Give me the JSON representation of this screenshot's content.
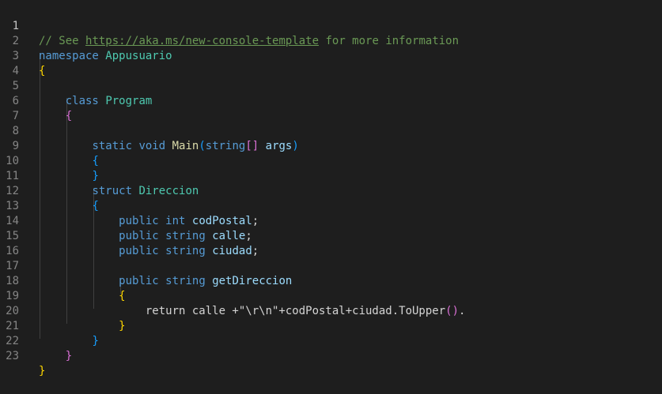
{
  "editor": {
    "line_numbers": [
      "1",
      "2",
      "3",
      "4",
      "5",
      "6",
      "7",
      "8",
      "9",
      "10",
      "11",
      "12",
      "13",
      "14",
      "15",
      "16",
      "17",
      "18",
      "19",
      "20",
      "21",
      "22",
      "23"
    ],
    "tokens": {
      "l1_comment_prefix": "// See ",
      "l1_link": "https://aka.ms/new-console-template",
      "l1_comment_suffix": " for more information",
      "kw_namespace": "namespace",
      "ns_name": "Appusuario",
      "brace_open": "{",
      "brace_close": "}",
      "kw_class": "class",
      "class_name": "Program",
      "kw_static": "static",
      "kw_void": "void",
      "method_main": "Main",
      "paren_open": "(",
      "kw_string": "string",
      "brackets": "[]",
      "param_args": "args",
      "paren_close": ")",
      "kw_struct": "struct",
      "struct_name": "Direccion",
      "kw_public": "public",
      "kw_int": "int",
      "field_codpostal": "codPostal",
      "semicolon": ";",
      "field_calle": "calle",
      "field_ciudad": "ciudad",
      "field_getdireccion": "getDireccion",
      "l19_return_text": "return calle +\"\\r\\n\"+codPostal+ciudad.ToUpper",
      "l19_parens": "()",
      "l19_period": "."
    }
  }
}
